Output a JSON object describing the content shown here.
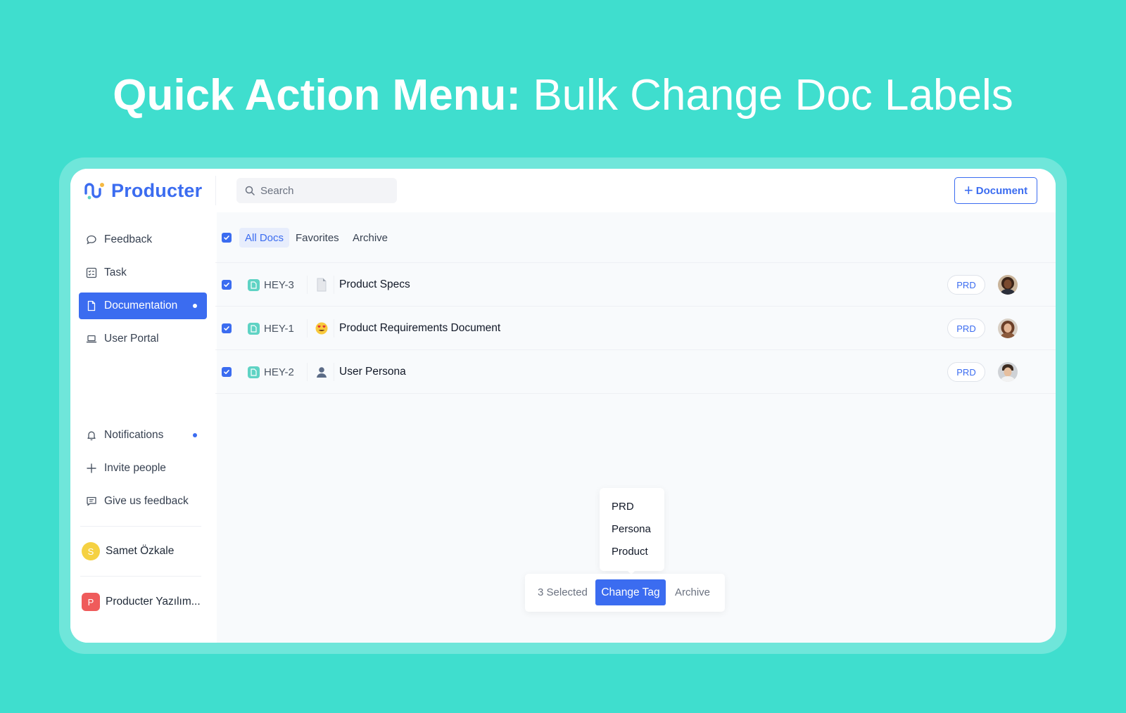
{
  "headline": {
    "bold": "Quick Action Menu:",
    "light": "Bulk Change Doc Labels"
  },
  "app": {
    "name": "Producter"
  },
  "search": {
    "placeholder": "Search"
  },
  "header": {
    "add_document_label": "Document"
  },
  "sidebar": {
    "items": [
      {
        "label": "Feedback",
        "icon": "chat-bubble-icon"
      },
      {
        "label": "Task",
        "icon": "checklist-icon"
      },
      {
        "label": "Documentation",
        "icon": "document-icon",
        "active": true
      },
      {
        "label": "User Portal",
        "icon": "laptop-icon"
      }
    ],
    "bottom_items": [
      {
        "label": "Notifications",
        "icon": "bell-icon"
      },
      {
        "label": "Invite people",
        "icon": "plus-icon"
      },
      {
        "label": "Give us feedback",
        "icon": "message-square-icon"
      }
    ],
    "user": {
      "initial": "S",
      "name": "Samet Özkale"
    },
    "workspace": {
      "initial": "P",
      "name": "Producter Yazılım..."
    }
  },
  "tabs": [
    "All Docs",
    "Favorites",
    "Archive"
  ],
  "docs": [
    {
      "id": "HEY-3",
      "emoji": "📄",
      "title": "Product Specs",
      "tag": "PRD"
    },
    {
      "id": "HEY-1",
      "emoji": "😍",
      "title": "Product Requirements Document",
      "tag": "PRD"
    },
    {
      "id": "HEY-2",
      "emoji": "👤",
      "title": "User Persona",
      "tag": "PRD"
    }
  ],
  "tag_menu": {
    "options": [
      "PRD",
      "Persona",
      "Product"
    ]
  },
  "action_bar": {
    "selected": "3 Selected",
    "change_tag": "Change Tag",
    "archive": "Archive"
  },
  "colors": {
    "background": "#3fdece",
    "accent": "#3b6cf0",
    "doc_icon": "#5fd3c4",
    "user_badge": "#f5d142",
    "workspace_badge": "#ef5b5b"
  }
}
